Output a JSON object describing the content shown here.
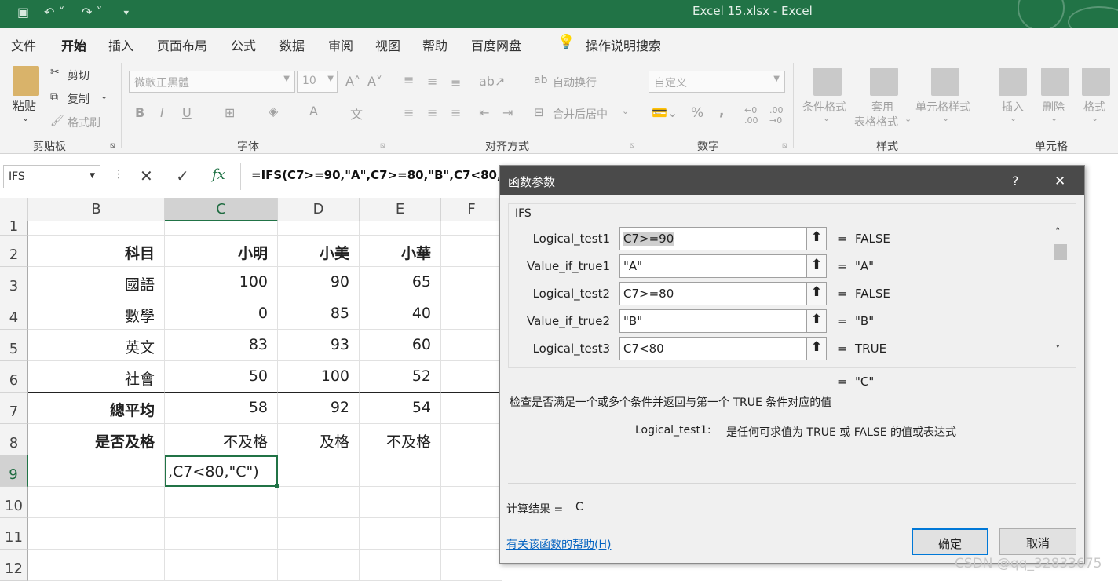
{
  "window": {
    "title": "Excel 15.xlsx  -  Excel"
  },
  "menu": [
    "文件",
    "开始",
    "插入",
    "页面布局",
    "公式",
    "数据",
    "审阅",
    "视图",
    "帮助",
    "百度网盘",
    "操作说明搜索"
  ],
  "ribbon": {
    "clipboard": {
      "paste": "粘贴",
      "cut": "剪切",
      "copy": "复制",
      "format_painter": "格式刷",
      "label": "剪贴板"
    },
    "font": {
      "family": "微軟正黑體",
      "size": "10",
      "label": "字体",
      "bold": "B",
      "italic": "I",
      "underline": "U"
    },
    "alignment": {
      "wrap": "自动换行",
      "merge": "合并后居中",
      "label": "对齐方式"
    },
    "number": {
      "format": "自定义",
      "percent": "%",
      "comma": ",",
      "label": "数字"
    },
    "styles": {
      "conditional": "条件格式",
      "table1": "套用",
      "table2": "表格格式",
      "cell_styles": "单元格样式",
      "label": "样式"
    },
    "cells": {
      "insert": "插入",
      "delete": "删除",
      "format": "格式",
      "label": "单元格"
    }
  },
  "formula_bar": {
    "name_box": "IFS",
    "fx": "fx",
    "formula": "=IFS(C7>=90,\"A\",C7>=80,\"B\",C7<80,\"C\")"
  },
  "sheet": {
    "columns": [
      "B",
      "C",
      "D",
      "E",
      "F"
    ],
    "rows": [
      "1",
      "2",
      "3",
      "4",
      "5",
      "6",
      "7",
      "8",
      "9",
      "10",
      "11",
      "12"
    ],
    "cells": [
      [
        "",
        "",
        "",
        "",
        ""
      ],
      [
        "科目",
        "小明",
        "小美",
        "小華",
        ""
      ],
      [
        "國語",
        "100",
        "90",
        "65",
        ""
      ],
      [
        "數學",
        "0",
        "85",
        "40",
        ""
      ],
      [
        "英文",
        "83",
        "93",
        "60",
        ""
      ],
      [
        "社會",
        "50",
        "100",
        "52",
        ""
      ],
      [
        "總平均",
        "58",
        "92",
        "54",
        ""
      ],
      [
        "是否及格",
        "不及格",
        "及格",
        "不及格",
        ""
      ],
      [
        "",
        ",C7<80,\"C\")",
        "",
        "",
        ""
      ],
      [
        "",
        "",
        "",
        "",
        ""
      ],
      [
        "",
        "",
        "",
        "",
        ""
      ],
      [
        "",
        "",
        "",
        "",
        ""
      ]
    ]
  },
  "dialog": {
    "title": "函数参数",
    "help_glyph": "?",
    "close_glyph": "✕",
    "function_name": "IFS",
    "args": [
      {
        "label": "Logical_test1",
        "value": "C7>=90",
        "result": "FALSE"
      },
      {
        "label": "Value_if_true1",
        "value": "\"A\"",
        "result": "\"A\""
      },
      {
        "label": "Logical_test2",
        "value": "C7>=80",
        "result": "FALSE"
      },
      {
        "label": "Value_if_true2",
        "value": "\"B\"",
        "result": "\"B\""
      },
      {
        "label": "Logical_test3",
        "value": "C7<80",
        "result": "TRUE"
      }
    ],
    "eq": "=",
    "overall_result": "\"C\"",
    "description": "检查是否满足一个或多个条件并返回与第一个 TRUE 条件对应的值",
    "arg_help_name": "Logical_test1:",
    "arg_help_text": "是任何可求值为 TRUE 或 FALSE 的值或表达式",
    "calc_label": "计算结果 =",
    "calc_value": "C",
    "help_link": "有关该函数的帮助(H)",
    "ok": "确定",
    "cancel": "取消"
  },
  "watermark": "CSDN @qq_32833675"
}
